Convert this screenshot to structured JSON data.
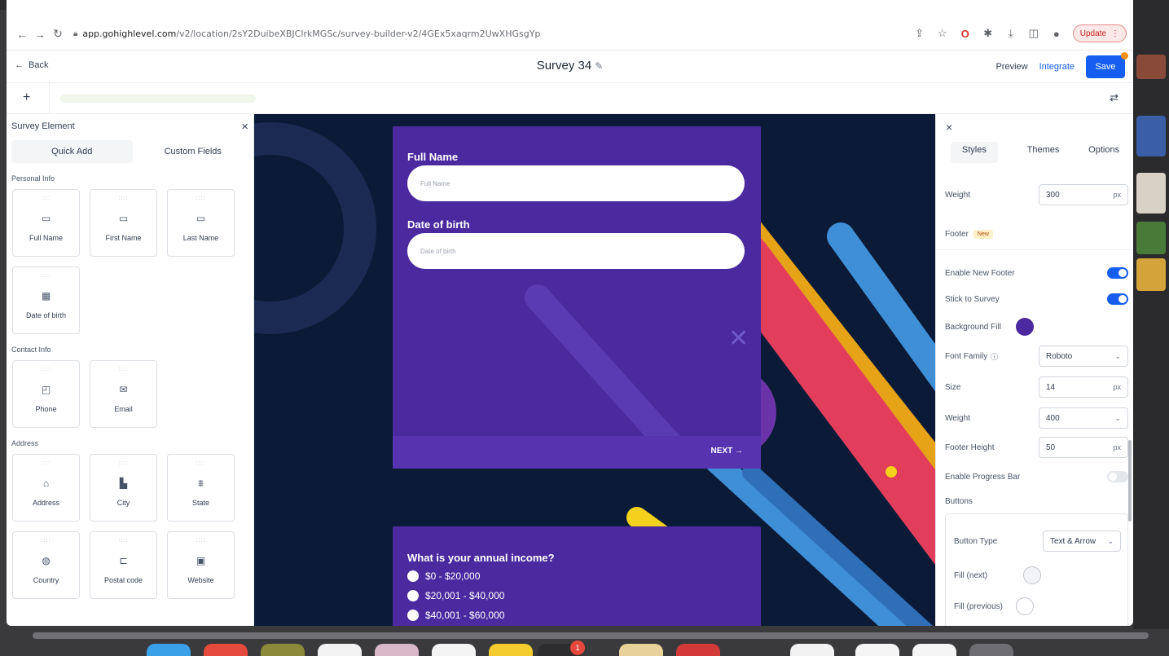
{
  "browser": {
    "url_host": "app.gohighlevel.com",
    "url_path": "/v2/location/2sY2DuibeXBJClrkMGSc/survey-builder-v2/4GEx5xaqrm2UwXHGsgYp",
    "update_label": "Update"
  },
  "header": {
    "back_label": "Back",
    "title": "Survey 34",
    "preview_label": "Preview",
    "integrate_label": "Integrate",
    "save_label": "Save"
  },
  "left_panel": {
    "title": "Survey Element",
    "tabs": [
      "Quick Add",
      "Custom Fields"
    ],
    "sections": [
      {
        "title": "Personal Info",
        "items": [
          {
            "label": "Full Name",
            "icon": "id-card-icon"
          },
          {
            "label": "First Name",
            "icon": "id-card-icon"
          },
          {
            "label": "Last Name",
            "icon": "id-card-icon"
          },
          {
            "label": "Date of birth",
            "icon": "calendar-icon"
          }
        ]
      },
      {
        "title": "Contact Info",
        "items": [
          {
            "label": "Phone",
            "icon": "phone-icon"
          },
          {
            "label": "Email",
            "icon": "mail-icon"
          }
        ]
      },
      {
        "title": "Address",
        "items": [
          {
            "label": "Address",
            "icon": "pin-icon"
          },
          {
            "label": "City",
            "icon": "city-icon"
          },
          {
            "label": "State",
            "icon": "state-icon"
          },
          {
            "label": "Country",
            "icon": "globe-icon"
          },
          {
            "label": "Postal code",
            "icon": "mailbox-icon"
          },
          {
            "label": "Website",
            "icon": "website-icon"
          }
        ]
      }
    ]
  },
  "canvas": {
    "card1": {
      "q1_label": "Full Name",
      "q1_placeholder": "Full Name",
      "q2_label": "Date of birth",
      "q2_placeholder": "Date of birth",
      "next_label": "NEXT →"
    },
    "card2": {
      "question": "What is your annual income?",
      "options": [
        "$0 - $20,000",
        "$20,001 - $40,000",
        "$40,001 - $60,000"
      ]
    }
  },
  "right_panel": {
    "tabs": [
      "Styles",
      "Themes",
      "Options"
    ],
    "weight_label": "Weight",
    "weight_value": "300",
    "unit_px": "px",
    "footer_label": "Footer",
    "new_badge": "New",
    "enable_new_footer": "Enable New Footer",
    "stick_to_survey": "Stick to Survey",
    "background_fill": "Background Fill",
    "font_family_label": "Font Family",
    "font_family_value": "Roboto",
    "size_label": "Size",
    "size_value": "14",
    "weight2_label": "Weight",
    "weight2_value": "400",
    "footer_height_label": "Footer Height",
    "footer_height_value": "50",
    "enable_progress_bar": "Enable Progress Bar",
    "buttons_label": "Buttons",
    "button_type_label": "Button Type",
    "button_type_value": "Text & Arrow",
    "fill_next_label": "Fill (next)",
    "fill_previous_label": "Fill (previous)"
  },
  "colors": {
    "primary": "#155eef",
    "card_purple": "#4b2a9f",
    "canvas_bg": "#0b1a36"
  }
}
